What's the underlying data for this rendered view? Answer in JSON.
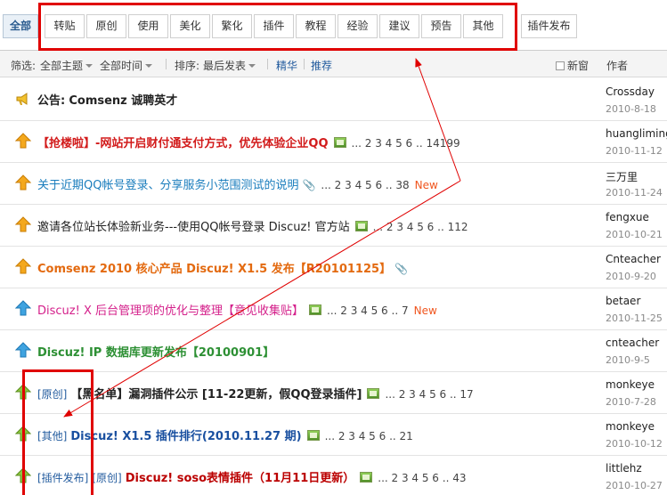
{
  "tabs": {
    "all_label": "全部",
    "items": [
      "转贴",
      "原创",
      "使用",
      "美化",
      "繁化",
      "插件",
      "教程",
      "经验",
      "建议",
      "预告",
      "其他"
    ],
    "plugin_release_label": "插件发布"
  },
  "filter": {
    "prefix": "筛选:",
    "topic_label": "全部主题",
    "time_label": "全部时间",
    "sort_prefix": "排序:",
    "sort_label": "最后发表",
    "digest_label": "精华",
    "recommend_label": "推荐",
    "newwin_label": "新窗",
    "author_header": "作者"
  },
  "threads": [
    {
      "prefix": "公告:",
      "title": "Comsenz 诚聘英才",
      "pages": "",
      "new": "",
      "author": "Crossday",
      "date": "2010-8-18"
    },
    {
      "prefix": "",
      "title": "【抢楼啦】-网站开启财付通支付方式，优先体验企业QQ",
      "pages": "... 2  3  4  5  6 .. 14199",
      "new": "",
      "author": "huangliming",
      "date": "2010-11-12"
    },
    {
      "prefix": "",
      "title": "关于近期QQ帐号登录、分享服务小范围测试的说明",
      "pages": "... 2  3  4  5  6 .. 38",
      "new": "New",
      "author": "三万里",
      "date": "2010-11-24"
    },
    {
      "prefix": "",
      "title": "邀请各位站长体验新业务---使用QQ帐号登录 Discuz! 官方站",
      "pages": "... 2  3  4  5  6 .. 112",
      "new": "",
      "author": "fengxue",
      "date": "2010-10-21"
    },
    {
      "prefix": "",
      "title": "Comsenz 2010 核心产品 Discuz! X1.5 发布【R20101125】",
      "pages": "",
      "new": "",
      "author": "Cnteacher",
      "date": "2010-9-20"
    },
    {
      "prefix": "",
      "title": "Discuz! X 后台管理项的优化与整理【意见收集贴】",
      "pages": "... 2  3  4  5  6 .. 7",
      "new": "New",
      "author": "betaer",
      "date": "2010-11-25"
    },
    {
      "prefix": "",
      "title": "Discuz! IP 数据库更新发布【20100901】",
      "pages": "",
      "new": "",
      "author": "cnteacher",
      "date": "2010-9-5"
    },
    {
      "type1": "[原创]",
      "title": "【黑名单】漏洞插件公示 [11-22更新，假QQ登录插件]",
      "pages": "... 2  3  4  5  6 .. 17",
      "new": "",
      "author": "monkeye",
      "date": "2010-7-28"
    },
    {
      "type1": "[其他]",
      "title": "Discuz! X1.5 插件排行(2010.11.27 期)",
      "pages": "... 2  3  4  5  6 .. 21",
      "new": "",
      "author": "monkeye",
      "date": "2010-10-12"
    },
    {
      "type1": "[插件发布]",
      "type2": "[原创]",
      "title": "Discuz! soso表情插件（11月11日更新）",
      "pages": "... 2  3  4  5  6 .. 43",
      "new": "",
      "author": "littlehz",
      "date": "2010-10-27"
    }
  ],
  "colors": {
    "highlight_red": "#e00000",
    "link_blue": "#225b9e",
    "new_orange": "#f0561f"
  }
}
